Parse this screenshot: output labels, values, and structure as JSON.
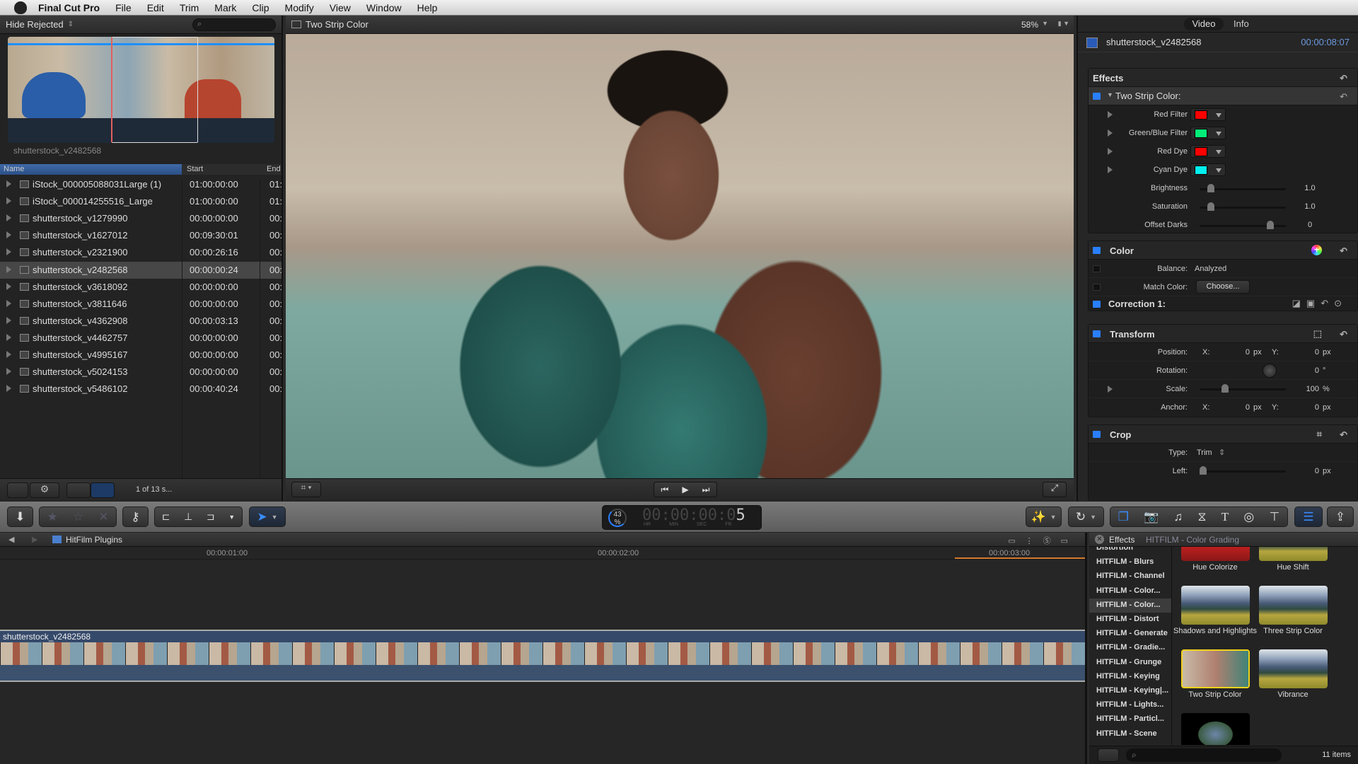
{
  "menubar": {
    "app": "Final Cut Pro",
    "items": [
      "File",
      "Edit",
      "Trim",
      "Mark",
      "Clip",
      "Modify",
      "View",
      "Window",
      "Help"
    ]
  },
  "browser": {
    "filter": "Hide Rejected",
    "clip_label": "shutterstock_v2482568",
    "columns": [
      "Name",
      "Start",
      "End"
    ],
    "rows": [
      {
        "name": "iStock_000005088031Large (1)",
        "start": "01:00:00:00",
        "end": "01:",
        "type": "image"
      },
      {
        "name": "iStock_000014255516_Large",
        "start": "01:00:00:00",
        "end": "01:",
        "type": "image"
      },
      {
        "name": "shutterstock_v1279990",
        "start": "00:00:00:00",
        "end": "00:",
        "type": "video"
      },
      {
        "name": "shutterstock_v1627012",
        "start": "00:09:30:01",
        "end": "00:",
        "type": "video"
      },
      {
        "name": "shutterstock_v2321900",
        "start": "00:00:26:16",
        "end": "00:",
        "type": "video"
      },
      {
        "name": "shutterstock_v2482568",
        "start": "00:00:00:24",
        "end": "00:",
        "type": "video",
        "selected": true
      },
      {
        "name": "shutterstock_v3618092",
        "start": "00:00:00:00",
        "end": "00:",
        "type": "video"
      },
      {
        "name": "shutterstock_v3811646",
        "start": "00:00:00:00",
        "end": "00:",
        "type": "video"
      },
      {
        "name": "shutterstock_v4362908",
        "start": "00:00:03:13",
        "end": "00:",
        "type": "video"
      },
      {
        "name": "shutterstock_v4462757",
        "start": "00:00:00:00",
        "end": "00:",
        "type": "video"
      },
      {
        "name": "shutterstock_v4995167",
        "start": "00:00:00:00",
        "end": "00:",
        "type": "video"
      },
      {
        "name": "shutterstock_v5024153",
        "start": "00:00:00:00",
        "end": "00:",
        "type": "video"
      },
      {
        "name": "shutterstock_v5486102",
        "start": "00:00:40:24",
        "end": "00:",
        "type": "video"
      }
    ],
    "status": "1 of 13 s..."
  },
  "viewer": {
    "title": "Two Strip Color",
    "zoom": "58%"
  },
  "inspector": {
    "tabs": [
      "Video",
      "Info"
    ],
    "active_tab": "Video",
    "clip": "shutterstock_v2482568",
    "duration": "00:00:08:07",
    "effects": {
      "title": "Effects",
      "effect": "Two Strip Color:",
      "colors": [
        {
          "label": "Red Filter",
          "color": "#ff0000"
        },
        {
          "label": "Green/Blue Filter",
          "color": "#00ee77"
        },
        {
          "label": "Red Dye",
          "color": "#ff0000"
        },
        {
          "label": "Cyan Dye",
          "color": "#00f0ee"
        }
      ],
      "sliders": [
        {
          "label": "Brightness",
          "value": "1.0",
          "pos": 0.1
        },
        {
          "label": "Saturation",
          "value": "1.0",
          "pos": 0.1
        },
        {
          "label": "Offset Darks",
          "value": "0",
          "pos": 0.85
        }
      ]
    },
    "color": {
      "title": "Color",
      "balance_label": "Balance:",
      "balance_value": "Analyzed",
      "match_label": "Match Color:",
      "match_button": "Choose...",
      "correction": "Correction 1:"
    },
    "transform": {
      "title": "Transform",
      "position_label": "Position:",
      "x": "X:",
      "y": "Y:",
      "pos_x": "0",
      "pos_y": "0",
      "unit_px": "px",
      "rotation_label": "Rotation:",
      "rotation": "0",
      "deg": "°",
      "scale_label": "Scale:",
      "scale": "100",
      "pct": "%",
      "scale_pos": 0.28,
      "anchor_label": "Anchor:",
      "anchor_x": "0",
      "anchor_y": "0"
    },
    "crop": {
      "title": "Crop",
      "type_label": "Type:",
      "type": "Trim",
      "left_label": "Left:",
      "left": "0"
    }
  },
  "toolbar": {
    "render_pct": "43",
    "pct_sign": "%",
    "timecode_dim": "00:00:00:0",
    "timecode_bright": "5",
    "tc_units": [
      "HR",
      "MIN",
      "SEC",
      "FR"
    ]
  },
  "timeline": {
    "project": "HitFilm Plugins",
    "ruler": [
      "00:00:01:00",
      "00:00:02:00",
      "00:00:03:00"
    ],
    "clip": "shutterstock_v2482568"
  },
  "effects_browser": {
    "title": "Effects",
    "category": "HITFILM - Color Grading",
    "categories": [
      "Distortion",
      "HITFILM - Blurs",
      "HITFILM - Channel",
      "HITFILM - Color...",
      "HITFILM - Color...",
      "HITFILM - Distort",
      "HITFILM - Generate",
      "HITFILM - Gradie...",
      "HITFILM - Grunge",
      "HITFILM - Keying",
      "HITFILM - Keying|...",
      "HITFILM - Lights...",
      "HITFILM - Particl...",
      "HITFILM - Scene"
    ],
    "selected_category": 4,
    "items": [
      "Hue Colorize",
      "Hue Shift",
      "Shadows and Highlights",
      "Three Strip Color",
      "Two Strip Color",
      "Vibrance"
    ],
    "selected_item": "Two Strip Color",
    "count": "11 items"
  }
}
